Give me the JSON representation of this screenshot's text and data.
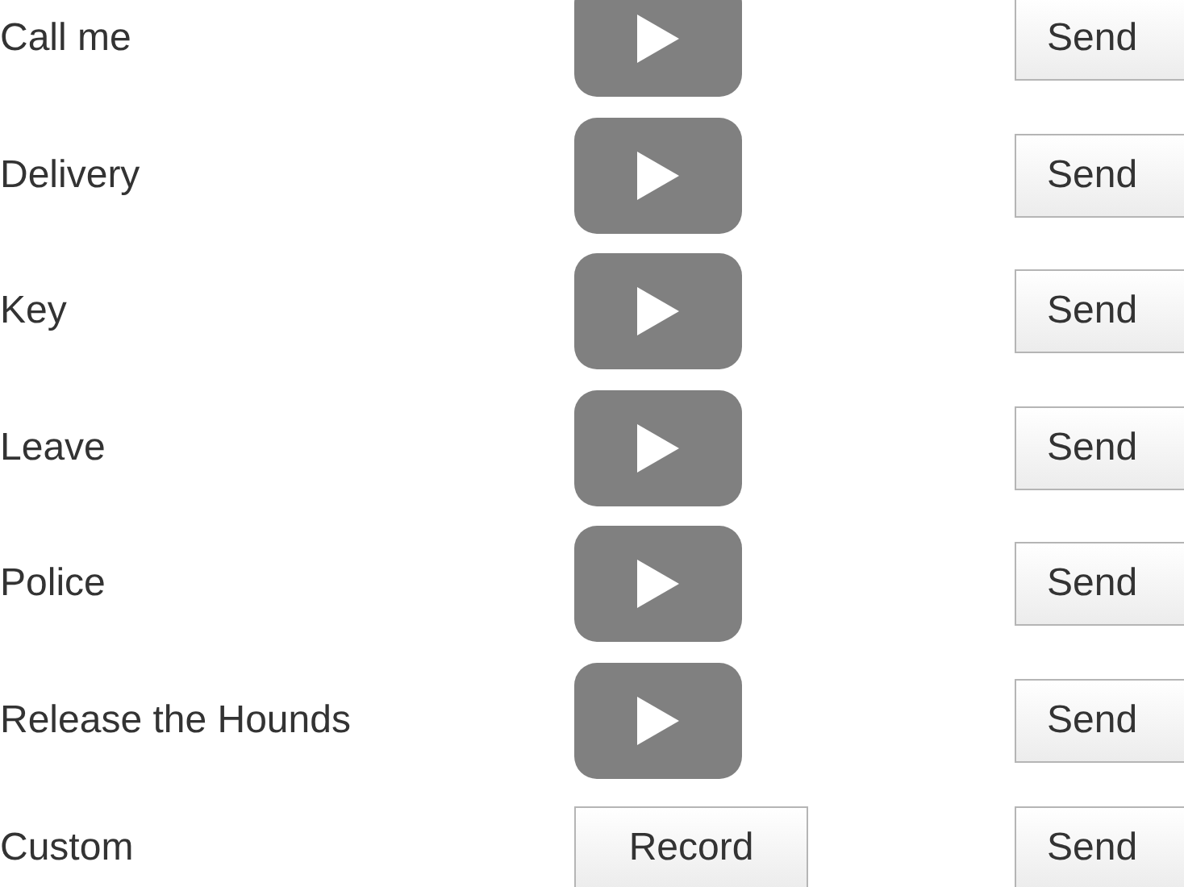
{
  "rows": [
    {
      "label": "Call me",
      "kind": "play",
      "send": "Send"
    },
    {
      "label": "Delivery",
      "kind": "play",
      "send": "Send"
    },
    {
      "label": "Key",
      "kind": "play",
      "send": "Send"
    },
    {
      "label": "Leave",
      "kind": "play",
      "send": "Send"
    },
    {
      "label": "Police",
      "kind": "play",
      "send": "Send"
    },
    {
      "label": "Release the Hounds",
      "kind": "play",
      "send": "Send"
    },
    {
      "label": "Custom",
      "kind": "record",
      "action": "Record",
      "send": "Send"
    }
  ]
}
